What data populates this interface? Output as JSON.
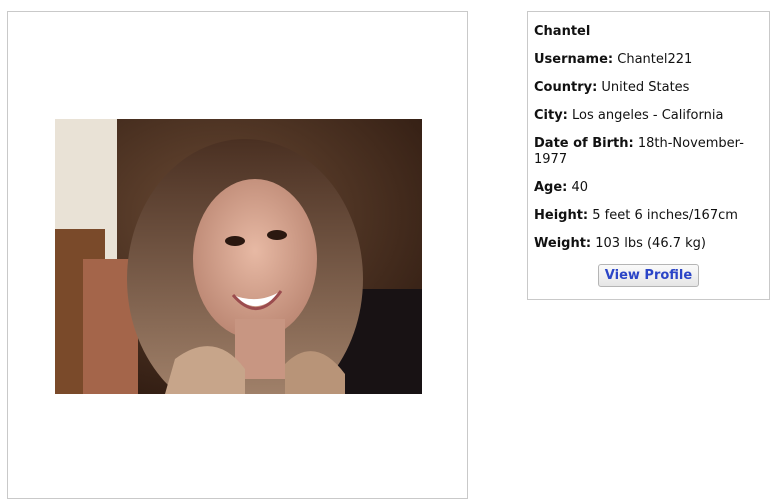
{
  "profile": {
    "name": "Chantel",
    "username_label": "Username:",
    "username": "Chantel221",
    "country_label": "Country:",
    "country": "United States",
    "city_label": "City:",
    "city": "Los angeles - California",
    "dob_label": "Date of Birth:",
    "dob": "18th-November-1977",
    "age_label": "Age:",
    "age": "40",
    "height_label": "Height:",
    "height": "5 feet 6 inches/167cm",
    "weight_label": "Weight:",
    "weight": "103 lbs (46.7 kg)",
    "button_label": "View Profile"
  },
  "colors": {
    "button_text": "#2b45c7",
    "border": "#c9c9c9"
  }
}
